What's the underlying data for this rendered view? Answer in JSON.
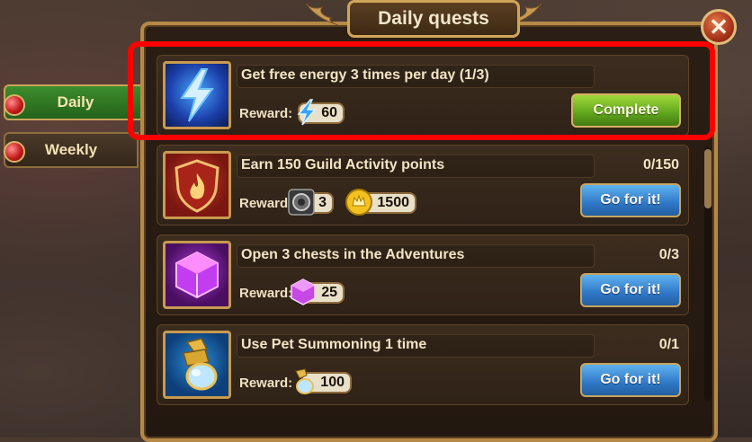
{
  "window": {
    "title": "Daily quests",
    "close_icon": "close-icon"
  },
  "tabs": [
    {
      "label": "Daily",
      "active": true
    },
    {
      "label": "Weekly",
      "active": false
    }
  ],
  "quests": [
    {
      "title": "Get free energy 3 times per day (1/3)",
      "progress": "",
      "reward_label": "Reward:",
      "icon": "energy-bolt-icon",
      "rewards": [
        {
          "icon": "energy-icon",
          "amount": "60"
        }
      ],
      "action": "Complete"
    },
    {
      "title": "Earn 150 Guild Activity points",
      "progress": "0/150",
      "reward_label": "Reward:",
      "icon": "guild-shield-icon",
      "rewards": [
        {
          "icon": "coin-stack-icon",
          "amount": "3"
        },
        {
          "icon": "gold-icon",
          "amount": "1500"
        }
      ],
      "action": "Go for it!"
    },
    {
      "title": "Open 3 chests in the Adventures",
      "progress": "0/3",
      "reward_label": "Reward:",
      "icon": "purple-cube-icon",
      "rewards": [
        {
          "icon": "emerald-cube-icon",
          "amount": "25"
        }
      ],
      "action": "Go for it!"
    },
    {
      "title": "Use Pet Summoning 1 time",
      "progress": "0/1",
      "reward_label": "Reward:",
      "icon": "pet-egg-icon",
      "rewards": [
        {
          "icon": "pet-egg-small-icon",
          "amount": "100"
        }
      ],
      "action": "Go for it!"
    }
  ],
  "colors": {
    "highlight": "#ff0000",
    "go_button": "#2f77c6",
    "complete_button": "#5ea41c",
    "frame": "#b58a47"
  }
}
